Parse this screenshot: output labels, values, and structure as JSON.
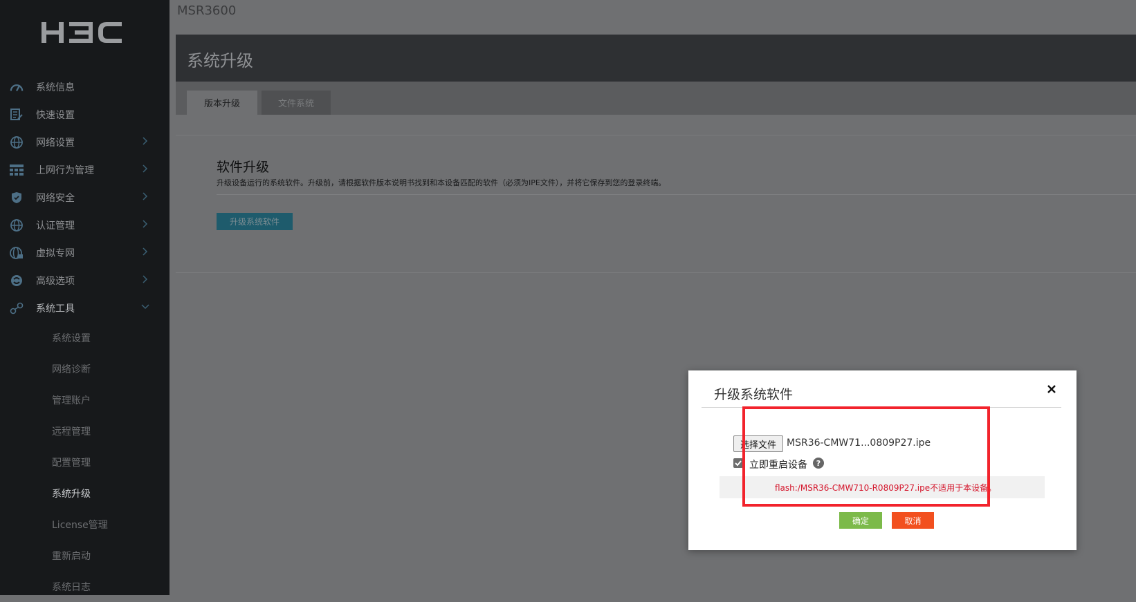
{
  "sidebar": {
    "brand": "H3C",
    "items": [
      {
        "label": "系统信息",
        "icon": "speedometer-icon",
        "arrow": false
      },
      {
        "label": "快速设置",
        "icon": "document-edit-icon",
        "arrow": false
      },
      {
        "label": "网络设置",
        "icon": "globe-icon",
        "arrow": true
      },
      {
        "label": "上网行为管理",
        "icon": "grid-table-icon",
        "arrow": true
      },
      {
        "label": "网络安全",
        "icon": "shield-icon",
        "arrow": true
      },
      {
        "label": "认证管理",
        "icon": "globe-icon",
        "arrow": true
      },
      {
        "label": "虚拟专网",
        "icon": "globe-lock-icon",
        "arrow": true
      },
      {
        "label": "高级选项",
        "icon": "advanced-icon",
        "arrow": true
      },
      {
        "label": "系统工具",
        "icon": "tools-icon",
        "arrow": "down"
      }
    ],
    "subitems": [
      "系统设置",
      "网络诊断",
      "管理账户",
      "远程管理",
      "配置管理",
      "系统升级",
      "License管理",
      "重新启动",
      "系统日志"
    ],
    "active_subitem": "系统升级"
  },
  "topbar": {
    "device": "MSR3600"
  },
  "page": {
    "title": "系统升级",
    "tabs": [
      "版本升级",
      "文件系统"
    ],
    "section_title": "软件升级",
    "section_desc": "升级设备运行的系统软件。升级前，请根据软件版本说明书找到和本设备匹配的软件（必须为IPE文件），并将它保存到您的登录终端。",
    "upgrade_button": "升级系统软件"
  },
  "dialog": {
    "title": "升级系统软件",
    "choose_file_label": "选择文件",
    "file_name": "MSR36-CMW71...0809P27.ipe",
    "reboot_label": "立即重启设备",
    "reboot_checked": true,
    "error_message": "flash:/MSR36-CMW710-R0809P27.ipe不适用于本设备。",
    "ok_label": "确定",
    "cancel_label": "取消"
  },
  "colors": {
    "sidebar_bg": "#17191b",
    "overlay_bg": "#6f7072",
    "primary_button": "#1e5b6c",
    "ok_button": "#7cba4a",
    "cancel_button": "#f2501f",
    "error_text": "#d4142a",
    "highlight_box": "#f2232c"
  }
}
